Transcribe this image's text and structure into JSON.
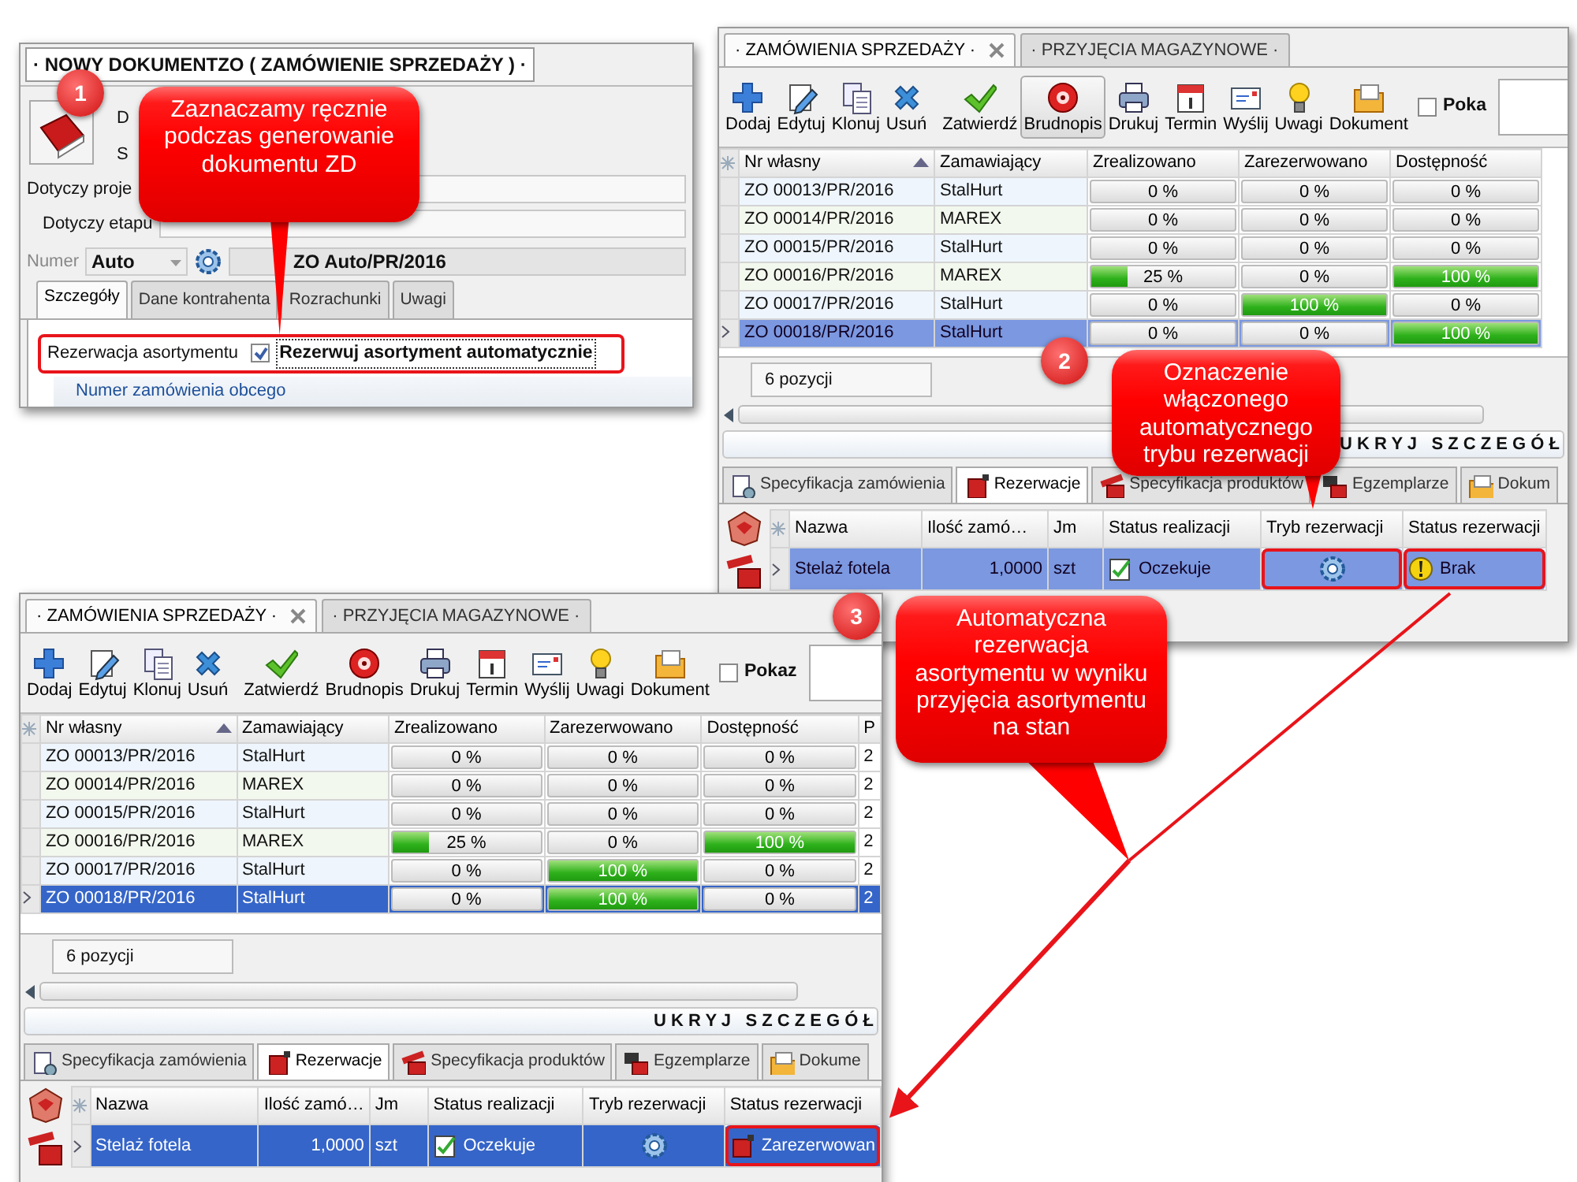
{
  "new_document": {
    "title": "· NOWY DOKUMENTZO ( ZAMÓWIENIE SPRZEDAŻY ) ·",
    "cut_labels": [
      "D",
      "S"
    ],
    "project_label": "Dotyczy proje",
    "stage_label": "Dotyczy etapu",
    "number_label": "Numer",
    "number_mode": "Auto",
    "number_value": "ZO Auto/PR/2016",
    "tabs": [
      {
        "label": "Szczegóły",
        "selected": true
      },
      {
        "label": "Dane kontrahenta",
        "selected": false
      },
      {
        "label": "Rozrachunki",
        "selected": false
      },
      {
        "label": "Uwagi",
        "selected": false
      }
    ],
    "reservation_label": "Rezerwacja asortymentu",
    "auto_reserve": {
      "label": "Rezerwuj asortyment automatycznie",
      "checked": true,
      "highlighted": true
    },
    "foreign_order_label": "Numer zamówienia obcego"
  },
  "order_windows": [
    {
      "tabs": [
        {
          "label": "· ZAMÓWIENIA SPRZEDAŻY ·",
          "selected": true,
          "closable": true
        },
        {
          "label": "· PRZYJĘCIA MAGAZYNOWE ·",
          "selected": false,
          "closable": false
        }
      ],
      "toolbar": [
        {
          "label": "Dodaj",
          "kind": "add",
          "pressed": false
        },
        {
          "label": "Edytuj",
          "kind": "edit",
          "pressed": false
        },
        {
          "label": "Klonuj",
          "kind": "clone",
          "pressed": false
        },
        {
          "label": "Usuń",
          "kind": "delete",
          "pressed": false
        },
        {
          "label": "Zatwierdź",
          "kind": "approve",
          "pressed": false
        },
        {
          "label": "Brudnopis",
          "kind": "draft",
          "pressed": true
        },
        {
          "label": "Drukuj",
          "kind": "print",
          "pressed": false
        },
        {
          "label": "Termin",
          "kind": "calendar",
          "pressed": false
        },
        {
          "label": "Wyślij",
          "kind": "send",
          "pressed": false
        },
        {
          "label": "Uwagi",
          "kind": "note",
          "pressed": false
        },
        {
          "label": "Dokument",
          "kind": "document",
          "pressed": false
        }
      ],
      "show_checkbox": {
        "label": "Poka",
        "checked": false
      },
      "columns": [
        "Nr własny",
        "Zamawiający",
        "Zrealizowano",
        "Zarezerwowano",
        "Dostępność"
      ],
      "rows": [
        {
          "number": "ZO 00013/PR/2016",
          "customer": "StalHurt",
          "realized": {
            "text": "0 %",
            "level": 0
          },
          "reserved": {
            "text": "0 %",
            "level": 0
          },
          "availability": {
            "text": "0 %",
            "level": 0
          },
          "selected": false
        },
        {
          "number": "ZO 00014/PR/2016",
          "customer": "MAREX",
          "realized": {
            "text": "0 %",
            "level": 0
          },
          "reserved": {
            "text": "0 %",
            "level": 0
          },
          "availability": {
            "text": "0 %",
            "level": 0
          },
          "selected": false
        },
        {
          "number": "ZO 00015/PR/2016",
          "customer": "StalHurt",
          "realized": {
            "text": "0 %",
            "level": 0
          },
          "reserved": {
            "text": "0 %",
            "level": 0
          },
          "availability": {
            "text": "0 %",
            "level": 0
          },
          "selected": false
        },
        {
          "number": "ZO 00016/PR/2016",
          "customer": "MAREX",
          "realized": {
            "text": "25 %",
            "level": 0.25
          },
          "reserved": {
            "text": "0 %",
            "level": 0
          },
          "availability": {
            "text": "100 %",
            "level": 1
          },
          "selected": false
        },
        {
          "number": "ZO 00017/PR/2016",
          "customer": "StalHurt",
          "realized": {
            "text": "0 %",
            "level": 0
          },
          "reserved": {
            "text": "100 %",
            "level": 1
          },
          "availability": {
            "text": "0 %",
            "level": 0
          },
          "selected": false
        },
        {
          "number": "ZO 00018/PR/2016",
          "customer": "StalHurt",
          "realized": {
            "text": "0 %",
            "level": 0
          },
          "reserved": {
            "text": "0 %",
            "level": 0
          },
          "availability": {
            "text": "100 %",
            "level": 1
          },
          "selected": true
        }
      ],
      "count": "6 pozycji",
      "hide_details": "U K R Y J   S Z C Z E G Ó Ł",
      "detail_tabs": [
        {
          "label": "Specyfikacja zamówienia",
          "selected": false,
          "kind": "spec"
        },
        {
          "label": "Rezerwacje",
          "selected": true,
          "kind": "reserve"
        },
        {
          "label": "Specyfikacja produktów",
          "selected": false,
          "kind": "products"
        },
        {
          "label": "Egzemplarze",
          "selected": false,
          "kind": "items"
        },
        {
          "label": "Dokum",
          "selected": false,
          "kind": "docs"
        }
      ],
      "detail_columns": [
        "Nazwa",
        "Ilość zamó…",
        "Jm",
        "Status realizacji",
        "Tryb rezerwacji",
        "Status rezerwacji"
      ],
      "detail_rows": [
        {
          "name": "Stelaż fotela",
          "qty": "1,0000",
          "unit": "szt",
          "status": "Oczekuje",
          "auto_mode": true,
          "mode_highlighted": true,
          "reservation_status": {
            "text": "Brak",
            "kind": "missing"
          },
          "status_highlighted": true
        }
      ]
    },
    {
      "tabs": [
        {
          "label": "· ZAMÓWIENIA SPRZEDAŻY ·",
          "selected": true,
          "closable": true
        },
        {
          "label": "· PRZYJĘCIA MAGAZYNOWE ·",
          "selected": false,
          "closable": false
        }
      ],
      "toolbar": [
        {
          "label": "Dodaj",
          "kind": "add",
          "pressed": false
        },
        {
          "label": "Edytuj",
          "kind": "edit",
          "pressed": false
        },
        {
          "label": "Klonuj",
          "kind": "clone",
          "pressed": false
        },
        {
          "label": "Usuń",
          "kind": "delete",
          "pressed": false
        },
        {
          "label": "Zatwierdź",
          "kind": "approve",
          "pressed": false
        },
        {
          "label": "Brudnopis",
          "kind": "draft",
          "pressed": false
        },
        {
          "label": "Drukuj",
          "kind": "print",
          "pressed": false
        },
        {
          "label": "Termin",
          "kind": "calendar",
          "pressed": false
        },
        {
          "label": "Wyślij",
          "kind": "send",
          "pressed": false
        },
        {
          "label": "Uwagi",
          "kind": "note",
          "pressed": false
        },
        {
          "label": "Dokument",
          "kind": "document",
          "pressed": false
        }
      ],
      "show_checkbox": {
        "label": "Pokaz",
        "checked": false
      },
      "columns": [
        "Nr własny",
        "Zamawiający",
        "Zrealizowano",
        "Zarezerwowano",
        "Dostępność",
        "P"
      ],
      "rows": [
        {
          "number": "ZO 00013/PR/2016",
          "customer": "StalHurt",
          "realized": {
            "text": "0 %",
            "level": 0
          },
          "reserved": {
            "text": "0 %",
            "level": 0
          },
          "availability": {
            "text": "0 %",
            "level": 0
          },
          "column_6": "2",
          "selected": false
        },
        {
          "number": "ZO 00014/PR/2016",
          "customer": "MAREX",
          "realized": {
            "text": "0 %",
            "level": 0
          },
          "reserved": {
            "text": "0 %",
            "level": 0
          },
          "availability": {
            "text": "0 %",
            "level": 0
          },
          "column_6": "2",
          "selected": false
        },
        {
          "number": "ZO 00015/PR/2016",
          "customer": "StalHurt",
          "realized": {
            "text": "0 %",
            "level": 0
          },
          "reserved": {
            "text": "0 %",
            "level": 0
          },
          "availability": {
            "text": "0 %",
            "level": 0
          },
          "column_6": "2",
          "selected": false
        },
        {
          "number": "ZO 00016/PR/2016",
          "customer": "MAREX",
          "realized": {
            "text": "25 %",
            "level": 0.25
          },
          "reserved": {
            "text": "0 %",
            "level": 0
          },
          "availability": {
            "text": "100 %",
            "level": 1
          },
          "column_6": "2",
          "selected": false
        },
        {
          "number": "ZO 00017/PR/2016",
          "customer": "StalHurt",
          "realized": {
            "text": "0 %",
            "level": 0
          },
          "reserved": {
            "text": "100 %",
            "level": 1
          },
          "availability": {
            "text": "0 %",
            "level": 0
          },
          "column_6": "2",
          "selected": false
        },
        {
          "number": "ZO 00018/PR/2016",
          "customer": "StalHurt",
          "realized": {
            "text": "0 %",
            "level": 0
          },
          "reserved": {
            "text": "100 %",
            "level": 1
          },
          "availability": {
            "text": "0 %",
            "level": 0
          },
          "column_6": "2",
          "selected": true
        }
      ],
      "count": "6 pozycji",
      "hide_details": "U K R Y J   S Z C Z E G Ó Ł",
      "detail_tabs": [
        {
          "label": "Specyfikacja zamówienia",
          "selected": false,
          "kind": "spec"
        },
        {
          "label": "Rezerwacje",
          "selected": true,
          "kind": "reserve"
        },
        {
          "label": "Specyfikacja produktów",
          "selected": false,
          "kind": "products"
        },
        {
          "label": "Egzemplarze",
          "selected": false,
          "kind": "items"
        },
        {
          "label": "Dokume",
          "selected": false,
          "kind": "docs"
        }
      ],
      "detail_columns": [
        "Nazwa",
        "Ilość zamó…",
        "Jm",
        "Status realizacji",
        "Tryb rezerwacji",
        "Status rezerwacji"
      ],
      "detail_rows": [
        {
          "name": "Stelaż fotela",
          "qty": "1,0000",
          "unit": "szt",
          "status": "Oczekuje",
          "auto_mode": true,
          "mode_highlighted": false,
          "reservation_status": {
            "text": "Zarezerwowan",
            "kind": "reserved"
          },
          "status_highlighted": true
        }
      ]
    }
  ],
  "callouts": [
    {
      "number": "1",
      "text": "Zaznaczamy ręcznie podczas generowanie dokumentu ZD"
    },
    {
      "number": "2",
      "text": "Oznaczenie włączonego automatycznego trybu rezerwacji"
    },
    {
      "number": "3",
      "text": "Automatyczna rezerwacja asortymentu w wyniku przyjęcia asortymentu na stan"
    }
  ]
}
